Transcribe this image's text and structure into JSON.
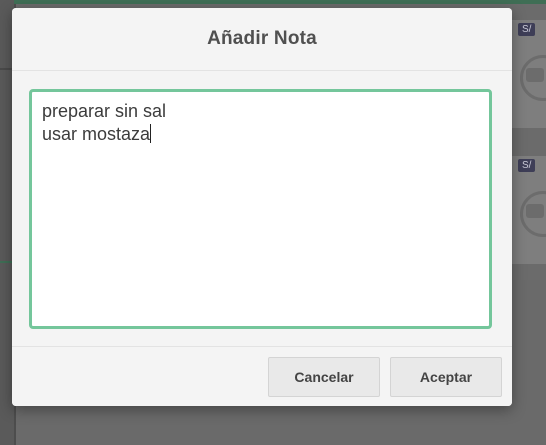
{
  "dialog": {
    "title": "Añadir Nota",
    "note_line_1": "preparar sin sal",
    "note_line_2": "usar mostaza",
    "cancel_label": "Cancelar",
    "accept_label": "Aceptar"
  },
  "background": {
    "badge_1": "S/",
    "badge_2": "S/"
  },
  "colors": {
    "accent_border": "#74c69b",
    "overlay": "#6b6b6b"
  },
  "icons": {
    "product_placeholder": "camera-off-icon"
  }
}
